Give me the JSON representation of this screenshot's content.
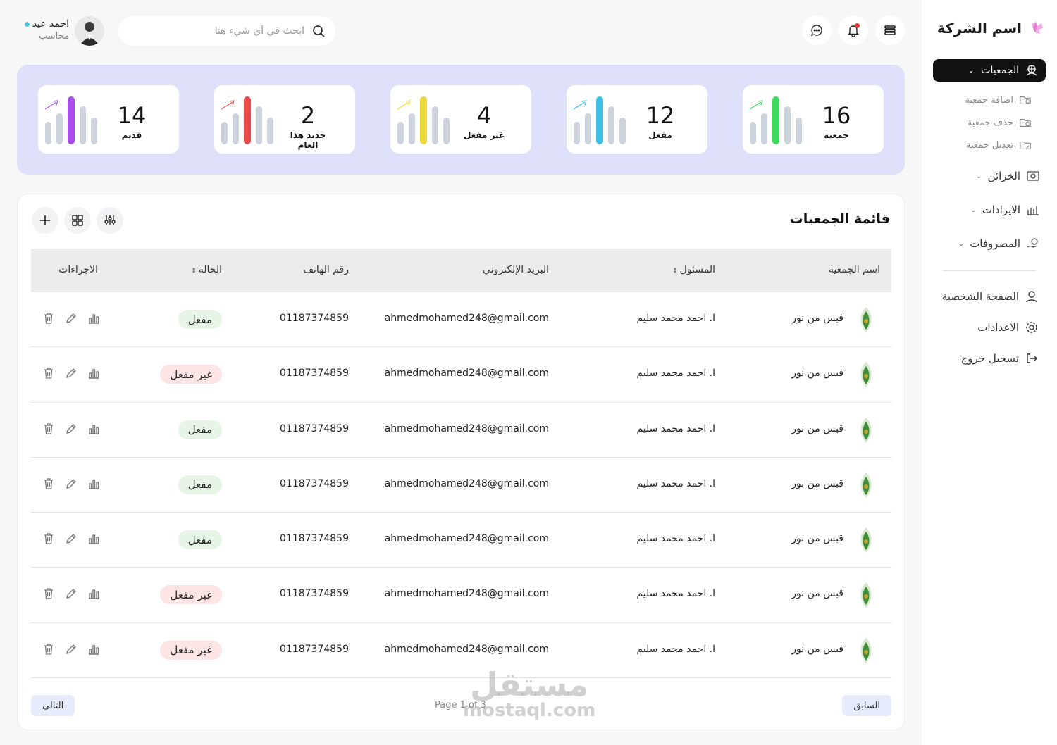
{
  "sidebar": {
    "brand": "اسم الشركة",
    "active_item": "الجمعيات",
    "sub_items": [
      "اضافة جمعية",
      "حذف جمعية",
      "تعديل جمعية"
    ],
    "items": [
      "الخزائن",
      "الايرادات",
      "المصروفات"
    ],
    "plain_items": [
      "الصفحة الشخصية",
      "الاعدادات",
      "تسجيل خروج"
    ]
  },
  "header": {
    "user_name": "احمد عيد",
    "user_role": "محاسب",
    "search_placeholder": "ابحث في أي شيء هنا"
  },
  "stats": [
    {
      "value": "16",
      "label": "جمعية",
      "accent": "#3ddc5c"
    },
    {
      "value": "12",
      "label": "مفعل",
      "accent": "#3ec1e8"
    },
    {
      "value": "4",
      "label": "غير مفعل",
      "accent": "#ecd93a"
    },
    {
      "value": "2",
      "label": "جديد هذا العام",
      "accent": "#e84a4a"
    },
    {
      "value": "14",
      "label": "قديم",
      "accent": "#a94ee8"
    }
  ],
  "table": {
    "title": "قائمة الجمعيات",
    "columns": {
      "name": "اسم الجمعية",
      "manager": "المسئول",
      "email": "البريد الإلكتروني",
      "phone": "رقم الهاتف",
      "status": "الحالة",
      "actions": "الاجراءات"
    },
    "rows": [
      {
        "name": "قبس من نور",
        "manager": "ا. احمد محمد سليم",
        "email": "ahmedmohamed248@gmail.com",
        "phone": "01187374859",
        "status": "مفعل",
        "active": true
      },
      {
        "name": "قبس من نور",
        "manager": "ا. احمد محمد سليم",
        "email": "ahmedmohamed248@gmail.com",
        "phone": "01187374859",
        "status": "غير مفعل",
        "active": false
      },
      {
        "name": "قبس من نور",
        "manager": "ا. احمد محمد سليم",
        "email": "ahmedmohamed248@gmail.com",
        "phone": "01187374859",
        "status": "مفعل",
        "active": true
      },
      {
        "name": "قبس من نور",
        "manager": "ا. احمد محمد سليم",
        "email": "ahmedmohamed248@gmail.com",
        "phone": "01187374859",
        "status": "مفعل",
        "active": true
      },
      {
        "name": "قبس من نور",
        "manager": "ا. احمد محمد سليم",
        "email": "ahmedmohamed248@gmail.com",
        "phone": "01187374859",
        "status": "مفعل",
        "active": true
      },
      {
        "name": "قبس من نور",
        "manager": "ا. احمد محمد سليم",
        "email": "ahmedmohamed248@gmail.com",
        "phone": "01187374859",
        "status": "غير مفعل",
        "active": false
      },
      {
        "name": "قبس من نور",
        "manager": "ا. احمد محمد سليم",
        "email": "ahmedmohamed248@gmail.com",
        "phone": "01187374859",
        "status": "غير مفعل",
        "active": false
      }
    ]
  },
  "pagination": {
    "prev": "السابق",
    "next": "التالي",
    "page_text": "Page 1 of 3"
  },
  "watermark": {
    "line1": "مستقل",
    "line2": "mostaql.com"
  }
}
